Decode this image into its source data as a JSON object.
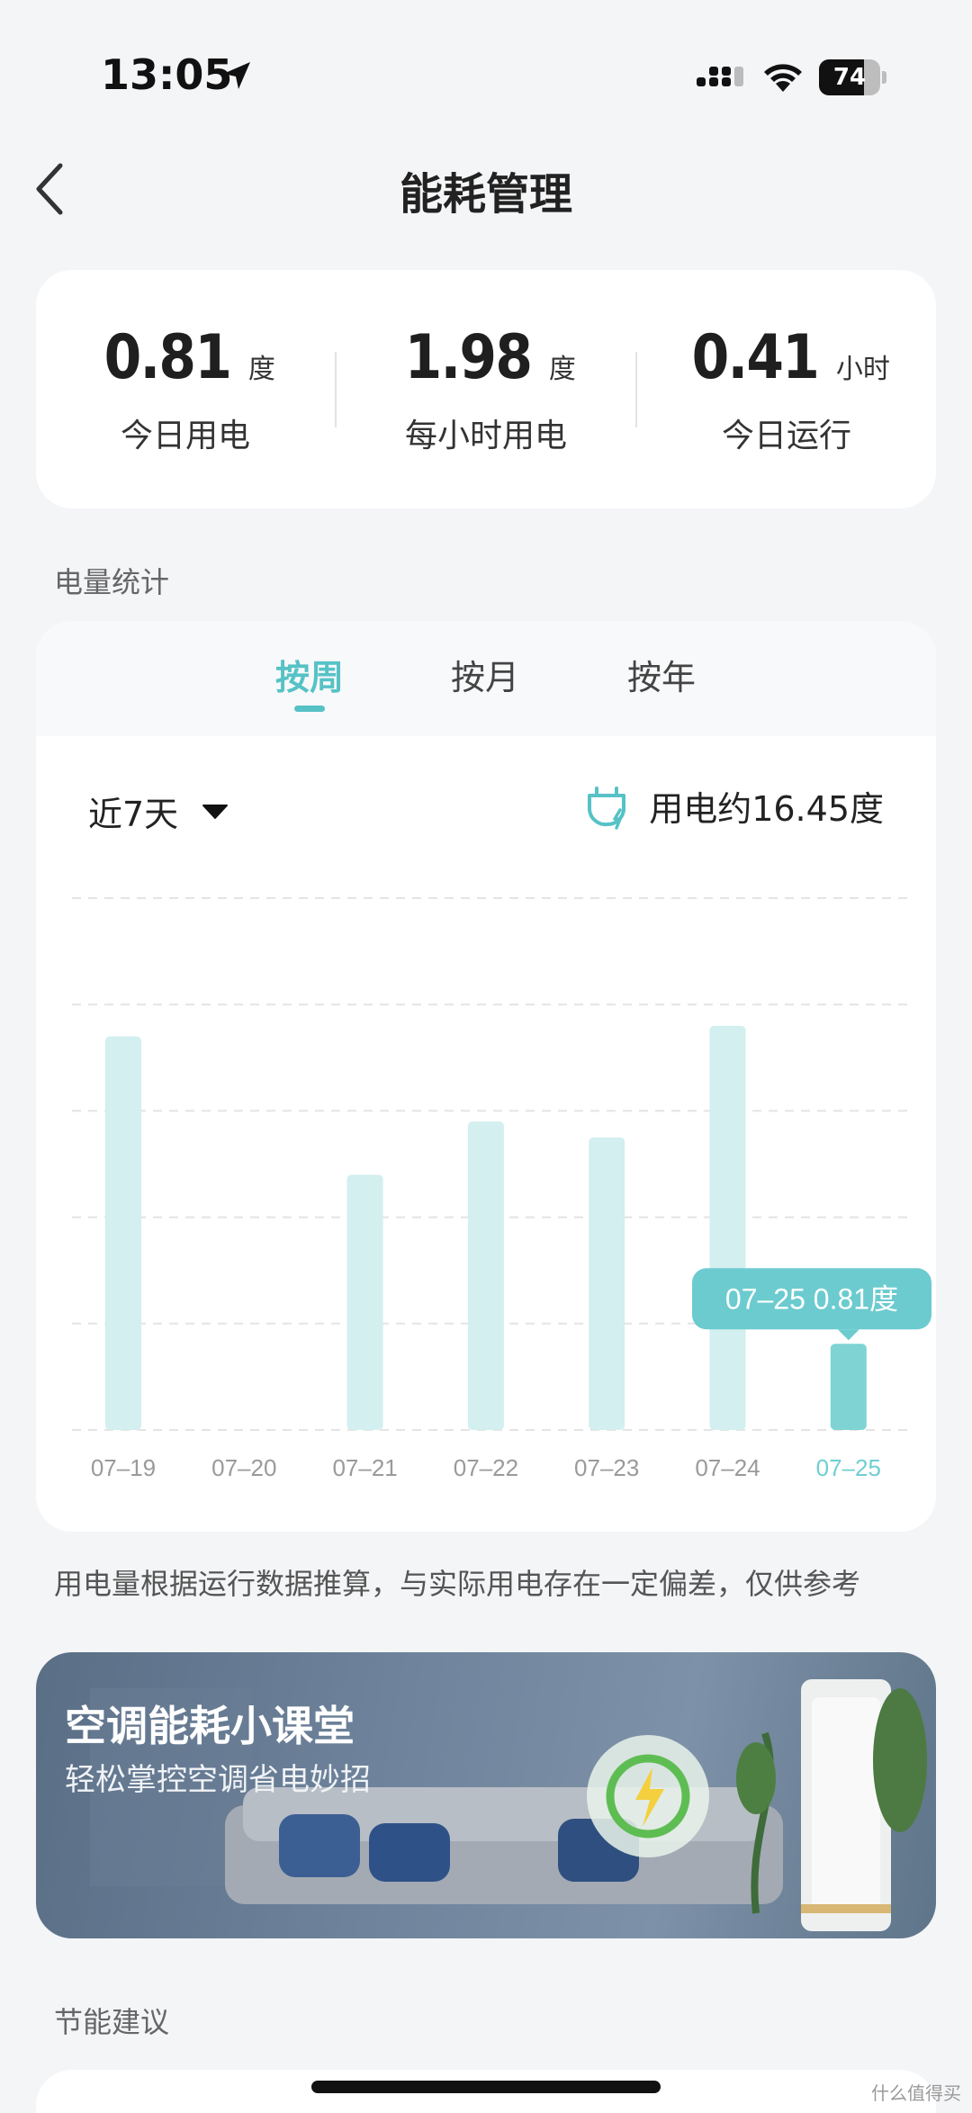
{
  "status_bar": {
    "time": "13:05",
    "battery": "74",
    "battery_level": 0.74,
    "icons": [
      "location-arrow-icon",
      "signal-icon",
      "wifi-icon",
      "battery-icon"
    ]
  },
  "nav": {
    "title": "能耗管理",
    "back_icon": "chevron-left-icon"
  },
  "summary": {
    "items": [
      {
        "value": "0.81",
        "unit": "度",
        "label": "今日用电"
      },
      {
        "value": "1.98",
        "unit": "度",
        "label": "每小时用电"
      },
      {
        "value": "0.41",
        "unit": "小时",
        "label": "今日运行"
      }
    ]
  },
  "stats_section": {
    "title": "电量统计",
    "tabs": [
      {
        "label": "按周",
        "active": true
      },
      {
        "label": "按月",
        "active": false
      },
      {
        "label": "按年",
        "active": false
      }
    ],
    "range_label": "近7天",
    "total_label": "用电约16.45度",
    "tooltip": "07–25 0.81度"
  },
  "chart_data": {
    "type": "bar",
    "categories": [
      "07–19",
      "07–20",
      "07–21",
      "07–22",
      "07–23",
      "07–24",
      "07–25"
    ],
    "values": [
      3.7,
      0,
      2.4,
      2.9,
      2.75,
      3.8,
      0.81
    ],
    "ylim": [
      0,
      5
    ],
    "grid": true,
    "highlight_index": 6,
    "colors": {
      "bar": "#d3efef",
      "highlight": "#7fd3d3",
      "label": "#9a9a9a",
      "highlight_label": "#6fcfd3"
    }
  },
  "footnote": "用电量根据运行数据推算，与实际用电存在一定偏差，仅供参考",
  "banner": {
    "title": "空调能耗小课堂",
    "subtitle": "轻松掌控空调省电妙招"
  },
  "tips_section": {
    "title": "节能建议"
  },
  "watermark": "什么值得买",
  "colors": {
    "accent": "#56c2c6",
    "background": "#f4f5f7"
  }
}
